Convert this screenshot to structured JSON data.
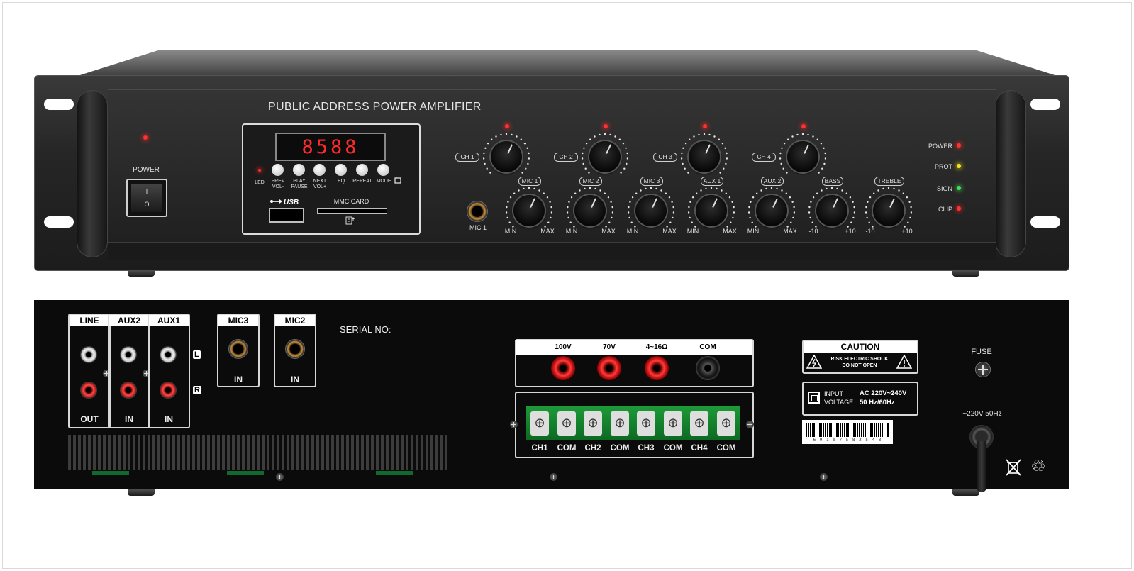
{
  "front_panel": {
    "title": "PUBLIC ADDRESS POWER AMPLIFIER",
    "power_label": "POWER",
    "switch_on_symbol": "I",
    "switch_off_symbol": "O",
    "display_readout": "8588",
    "led_label": "LED",
    "player_buttons": [
      {
        "line1": "PREV",
        "line2": "VOL-"
      },
      {
        "line1": "PLAY",
        "line2": "PAUSE"
      },
      {
        "line1": "NEXT",
        "line2": "VOL+"
      },
      {
        "line1": "EQ",
        "line2": ""
      },
      {
        "line1": "REPEAT",
        "line2": ""
      },
      {
        "line1": "MODE",
        "line2": ""
      }
    ],
    "usb_label": "USB",
    "mmc_label": "MMC CARD",
    "mic_jack_label": "MIC 1",
    "channel_knobs": [
      "CH 1",
      "CH 2",
      "CH 3",
      "CH 4"
    ],
    "input_knobs": [
      {
        "label": "MIC 1",
        "min": "MIN",
        "max": "MAX"
      },
      {
        "label": "MIC 2",
        "min": "MIN",
        "max": "MAX"
      },
      {
        "label": "MIC 3",
        "min": "MIN",
        "max": "MAX"
      },
      {
        "label": "AUX 1",
        "min": "MIN",
        "max": "MAX"
      },
      {
        "label": "AUX 2",
        "min": "MIN",
        "max": "MAX"
      },
      {
        "label": "BASS",
        "min": "-10",
        "max": "+10"
      },
      {
        "label": "TREBLE",
        "min": "-10",
        "max": "+10"
      }
    ],
    "status_leds": [
      {
        "label": "POWER",
        "color": "#ff3030"
      },
      {
        "label": "PROT",
        "color": "#f5e51e"
      },
      {
        "label": "SIGN",
        "color": "#3fe05a"
      },
      {
        "label": "CLIP",
        "color": "#ff3030"
      }
    ]
  },
  "rear_panel": {
    "rca_groups": [
      {
        "label": "LINE",
        "direction": "OUT"
      },
      {
        "label": "AUX2",
        "direction": "IN"
      },
      {
        "label": "AUX1",
        "direction": "IN"
      }
    ],
    "lr_labels": [
      "L",
      "R"
    ],
    "mic_inputs": [
      {
        "label": "MIC3",
        "direction": "IN"
      },
      {
        "label": "MIC2",
        "direction": "IN"
      }
    ],
    "serial_label": "SERIAL NO:",
    "speaker_outputs": [
      "100V",
      "70V",
      "4~16Ω",
      "COM"
    ],
    "zone_terminals": [
      "CH1",
      "COM",
      "CH2",
      "COM",
      "CH3",
      "COM",
      "CH4",
      "COM"
    ],
    "caution_title": "CAUTION",
    "caution_line1": "RISK ELECTRIC SHOCK",
    "caution_line2": "DO NOT OPEN",
    "input_voltage_label1": "INPUT",
    "input_voltage_label2": "VOLTAGE:",
    "input_voltage_value1": "AC 220V~240V",
    "input_voltage_value2": "50 Hz/60Hz",
    "barcode_number": "6 9 1 0 7 5   8 2 5 4 3",
    "fuse_label": "FUSE",
    "mains_label": "~220V  50Hz"
  }
}
